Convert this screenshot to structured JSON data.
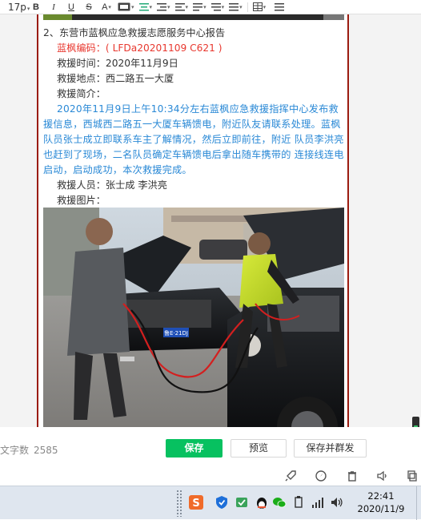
{
  "toolbar": {
    "font_size": "17p",
    "items": [
      "bold-icon",
      "italic-icon",
      "underline-icon",
      "strikethrough-icon",
      "font-color-icon",
      "background-color-icon",
      "align-center-icon",
      "indent-icon",
      "outdent-icon",
      "list-icon",
      "line-spacing-icon",
      "paragraph-icon",
      "table-icon",
      "more-icon"
    ]
  },
  "article": {
    "heading": "2、东营市蓝枫应急救援志愿服务中心报告",
    "code_label": "蓝枫编码：( LFDa20201109  C621 )",
    "time_label": "救援时间：2020年11月9日",
    "location_label": "救援地点：西二路五一大厦",
    "summary_label": "救援简介：",
    "summary_text": "2020年11月9日上午10:34分左右蓝枫应急救援指挥中心发布救援信息，西城西二路五一大厦车辆馈电，附近队友请联系处理。蓝枫队员张士成立即联系车主了解情况，然后立即前往，附近 队员李洪亮也赶到了现场，二名队员确定车辆馈电后拿出随车携带的 连接线连电启动，启动成功，本次救援完成。",
    "rescuers_label": "救援人员：张士成    李洪亮",
    "photo_label": "救援图片："
  },
  "photo": {
    "plate_text": "鲁E·21DJ"
  },
  "footer": {
    "wordcount_label": "文字数",
    "wordcount_value": "2585",
    "save_label": "保存",
    "preview_label": "预览",
    "save_and_send_label": "保存并群发"
  },
  "taskbar": {
    "time": "22:41",
    "date": "2020/11/9"
  },
  "colors": {
    "accent_green": "#07c160",
    "highlight_red": "#e8382f",
    "body_blue": "#2a89d6",
    "frame_red": "#9b1b10"
  }
}
